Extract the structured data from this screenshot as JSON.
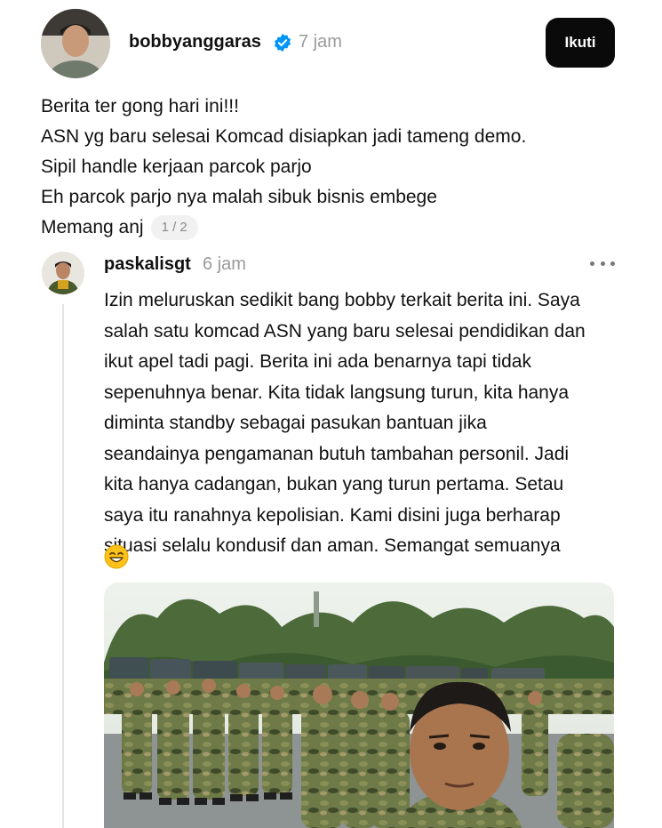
{
  "post": {
    "username": "bobbyanggaras",
    "time": "7 jam",
    "follow_label": "Ikuti",
    "lines": [
      "Berita ter gong hari ini!!!",
      "ASN yg baru selesai Komcad disiapkan jadi tameng demo.",
      "Sipil handle kerjaan parcok parjo",
      "Eh parcok parjo nya malah sibuk bisnis embege",
      "Memang anj"
    ],
    "page_counter": "1 / 2"
  },
  "reply": {
    "username": "paskalisgt",
    "time": "6 jam",
    "lines": [
      "Izin meluruskan sedikit bang bobby terkait berita ini. Saya",
      "salah satu komcad ASN yang baru selesai pendidikan dan",
      "ikut apel tadi pagi. Berita ini ada benarnya tapi tidak",
      "sepenuhnya benar. Kita tidak langsung turun, kita hanya",
      "diminta standby sebagai pasukan bantuan jika",
      "seandainya pengamanan butuh tambahan personil. Jadi",
      "kita hanya cadangan, bukan yang turun pertama. Setau",
      "saya itu ranahnya kepolisian. Kami disini juga berharap",
      "situasi selalu kondusif dan aman. Semangat semuanya"
    ],
    "emoji": "grinning-squinting-face"
  },
  "icons": {
    "verified": "verified-badge-icon",
    "more": "more-options-icon"
  },
  "colors": {
    "verified_badge": "#0095f6",
    "follow_button_bg": "#0a0a0a",
    "timestamp": "#9a9a9a",
    "camo_green": "#5c6b3a"
  }
}
